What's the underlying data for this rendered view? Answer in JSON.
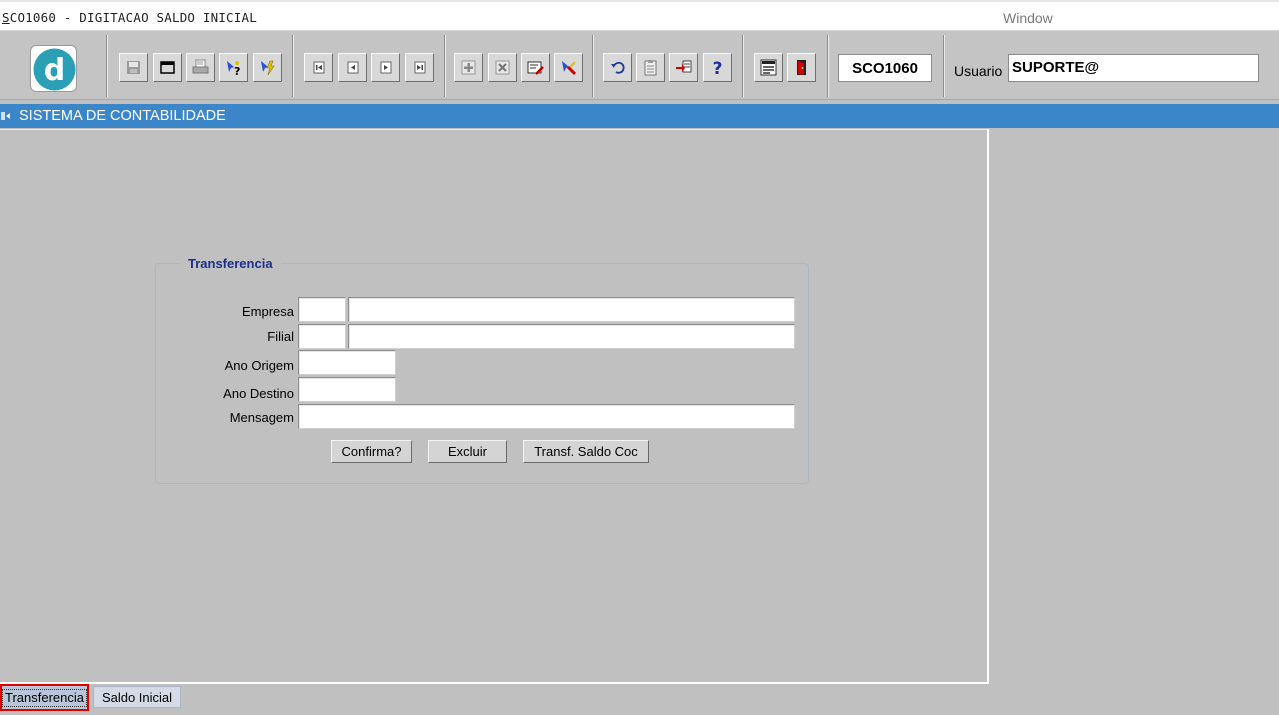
{
  "window": {
    "title_first": "S",
    "title_rest": "CO1060 - DIGITACAO SALDO INICIAL",
    "menu_window": "Window"
  },
  "toolbar": {
    "logo_letter": "d",
    "form_code": "SCO1060",
    "user_label": "Usuario",
    "user_value": "SUPORTE@",
    "icons": [
      "save-icon",
      "window-icon",
      "print-icon",
      "query-help-icon",
      "execute-query-icon",
      "first-record-icon",
      "previous-record-icon",
      "next-record-icon",
      "last-record-icon",
      "insert-record-icon",
      "delete-record-icon",
      "edit-record-icon",
      "clear-record-icon",
      "undo-icon",
      "copy-icon",
      "list-values-icon",
      "help-icon",
      "menu-icon",
      "exit-icon"
    ]
  },
  "header": {
    "title": "SISTEMA DE CONTABILIDADE"
  },
  "form": {
    "group_title": "Transferencia",
    "labels": {
      "empresa": "Empresa",
      "filial": "Filial",
      "ano_origem": "Ano Origem",
      "ano_destino": "Ano Destino",
      "mensagem": "Mensagem"
    },
    "values": {
      "empresa_code": "",
      "empresa_name": "",
      "filial_code": "",
      "filial_name": "",
      "ano_origem": "",
      "ano_destino": "",
      "mensagem": ""
    },
    "buttons": {
      "confirma": "Confirma?",
      "excluir": "Excluir",
      "transf": "Transf. Saldo Coc"
    }
  },
  "tabs": {
    "transferencia": "Transferencia",
    "saldo_inicial": "Saldo Inicial"
  },
  "colors": {
    "header_blue": "#3a86c8",
    "group_title": "#1c2f8a",
    "active_tab_outline": "#e00000"
  }
}
